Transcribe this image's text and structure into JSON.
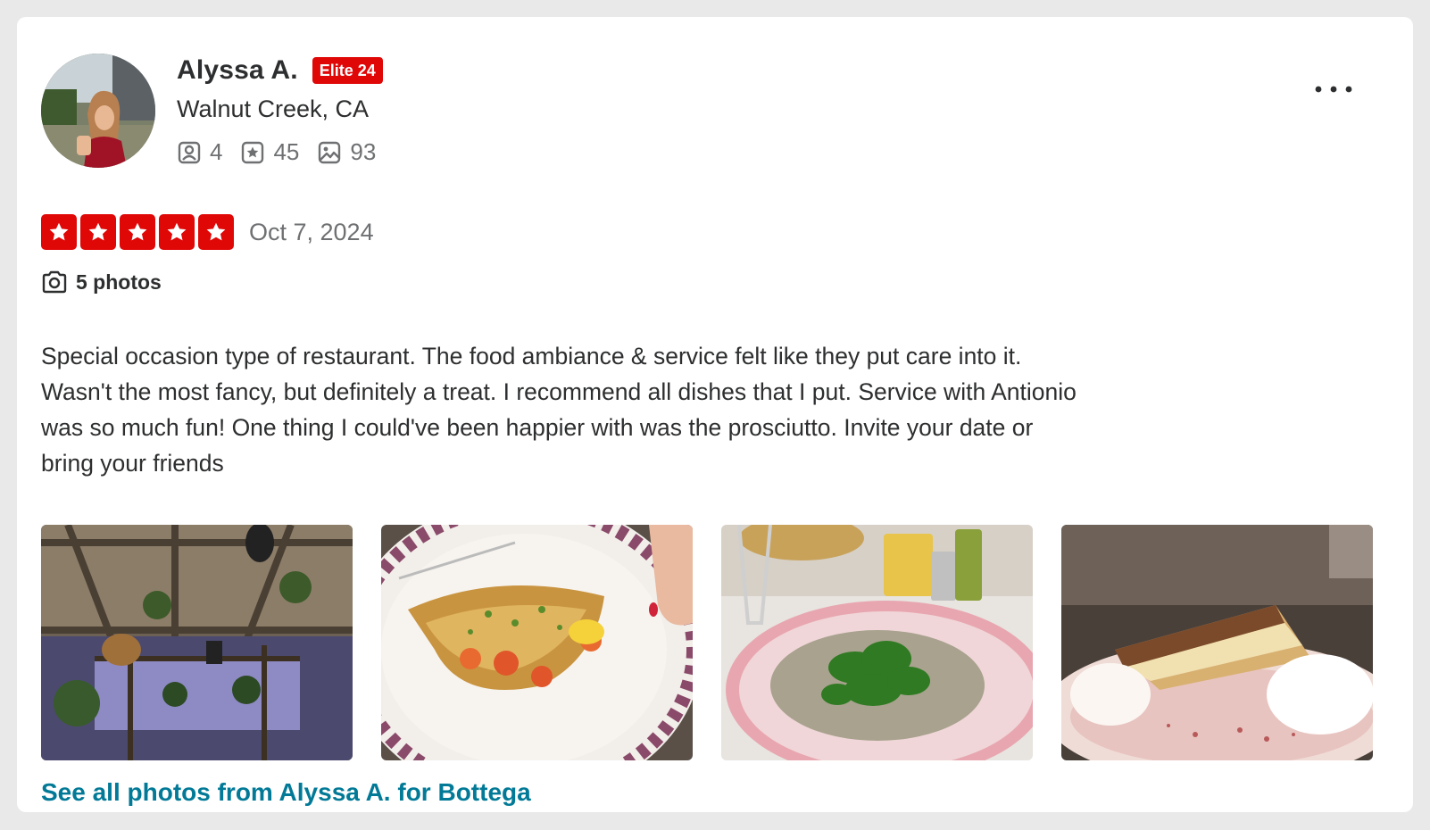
{
  "review": {
    "user": {
      "name": "Alyssa A.",
      "elite_badge": "Elite 24",
      "location": "Walnut Creek, CA",
      "stats": {
        "friends": "4",
        "reviews": "45",
        "photos": "93"
      }
    },
    "rating": 5,
    "date": "Oct 7, 2024",
    "photos_label": "5 photos",
    "text_lines": [
      "Special occasion type of restaurant. The food ambiance & service felt like they put care into it.",
      "Wasn't the most fancy, but definitely a treat. I recommend all dishes that I put. Service with Antionio",
      "was so much fun! One thing I could've been happier with was the prosciutto. Invite your date or",
      "bring your friends"
    ],
    "see_all_link": "See all photos from Alyssa A. for Bottega"
  },
  "colors": {
    "star_red": "#e00707",
    "link_teal": "#027a97",
    "muted_gray": "#6e7072",
    "text_dark": "#2d2e2f"
  },
  "icons": {
    "friends": "friends-icon",
    "reviews": "star-badge-icon",
    "photos": "image-icon",
    "camera": "camera-icon",
    "more": "more-options-icon"
  }
}
